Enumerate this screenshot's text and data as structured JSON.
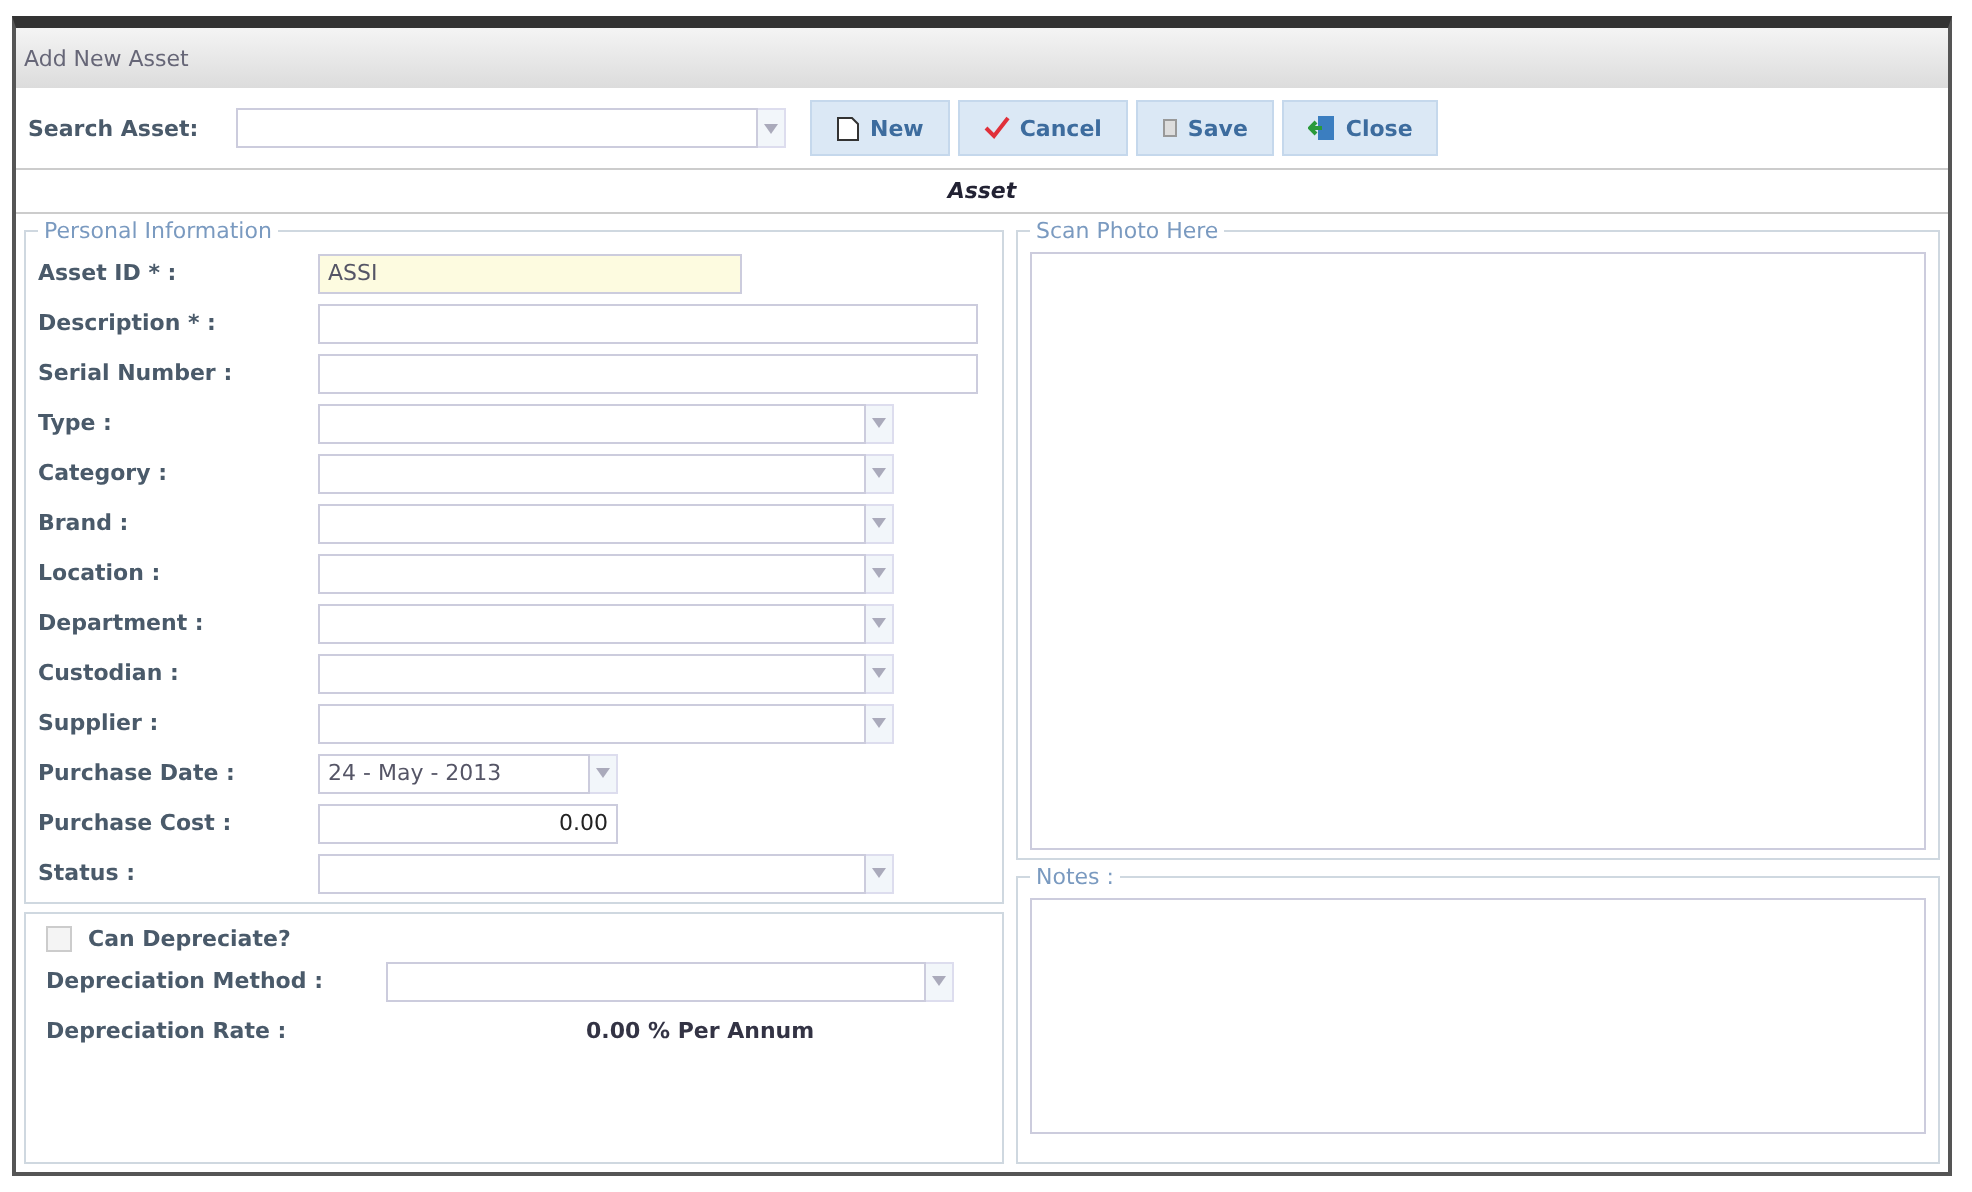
{
  "window": {
    "title": "Add New Asset"
  },
  "toolbar": {
    "search_label": "Search Asset:",
    "buttons": [
      {
        "label": "New",
        "kind": "new"
      },
      {
        "label": "Cancel",
        "kind": "cancel"
      },
      {
        "label": "Save",
        "kind": "save"
      },
      {
        "label": "Close",
        "kind": "close"
      }
    ]
  },
  "heading": "Asset",
  "personal_information": {
    "legend": "Personal Information",
    "fields": [
      {
        "label": "Asset ID * :",
        "kind": "id",
        "value": "ASSI"
      },
      {
        "label": "Description * :",
        "kind": "text"
      },
      {
        "label": "Serial Number :",
        "kind": "text"
      },
      {
        "label": "Type :",
        "kind": "combo"
      },
      {
        "label": "Category :",
        "kind": "combo"
      },
      {
        "label": "Brand :",
        "kind": "combo"
      },
      {
        "label": "Location :",
        "kind": "combo"
      },
      {
        "label": "Department :",
        "kind": "combo"
      },
      {
        "label": "Custodian :",
        "kind": "combo"
      },
      {
        "label": "Supplier :",
        "kind": "combo"
      },
      {
        "label": "Purchase Date :",
        "kind": "date",
        "value": "24 - May - 2013"
      },
      {
        "label": "Purchase Cost :",
        "kind": "number",
        "value": "0.00"
      },
      {
        "label": "Status :",
        "kind": "combo"
      }
    ]
  },
  "depreciation": {
    "checkbox": {
      "label": "Can Depreciate?",
      "checked": false
    },
    "method_label": "Depreciation Method :",
    "rate_label": "Depreciation Rate :",
    "rate_value": "0.00 % Per Annum"
  },
  "photo": {
    "legend": "Scan Photo Here"
  },
  "notes": {
    "legend": "Notes :"
  }
}
